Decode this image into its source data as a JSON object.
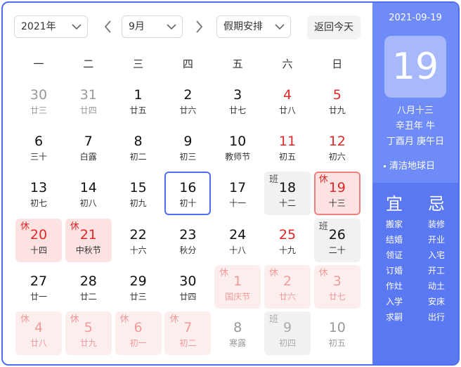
{
  "toolbar": {
    "year_select": "2021年",
    "month_select": "9月",
    "holiday_select": "假期安排",
    "today_button": "返回今天",
    "prev_icon": "chevron-left-icon",
    "next_icon": "chevron-right-icon"
  },
  "weekdays": [
    "一",
    "二",
    "三",
    "四",
    "五",
    "六",
    "日"
  ],
  "weeks": [
    [
      {
        "day": "30",
        "lunar": "廿三",
        "kind": "other"
      },
      {
        "day": "31",
        "lunar": "廿四",
        "kind": "other"
      },
      {
        "day": "1",
        "lunar": "廿五",
        "kind": "normal"
      },
      {
        "day": "2",
        "lunar": "廿六",
        "kind": "normal"
      },
      {
        "day": "3",
        "lunar": "廿七",
        "kind": "normal"
      },
      {
        "day": "4",
        "lunar": "廿八",
        "kind": "weekend"
      },
      {
        "day": "5",
        "lunar": "廿九",
        "kind": "weekend"
      }
    ],
    [
      {
        "day": "6",
        "lunar": "三十",
        "kind": "normal"
      },
      {
        "day": "7",
        "lunar": "白露",
        "kind": "normal"
      },
      {
        "day": "8",
        "lunar": "初二",
        "kind": "normal"
      },
      {
        "day": "9",
        "lunar": "初三",
        "kind": "normal"
      },
      {
        "day": "10",
        "lunar": "教师节",
        "kind": "normal"
      },
      {
        "day": "11",
        "lunar": "初五",
        "kind": "weekend"
      },
      {
        "day": "12",
        "lunar": "初六",
        "kind": "weekend"
      }
    ],
    [
      {
        "day": "13",
        "lunar": "初七",
        "kind": "normal"
      },
      {
        "day": "14",
        "lunar": "初八",
        "kind": "normal"
      },
      {
        "day": "15",
        "lunar": "初九",
        "kind": "normal"
      },
      {
        "day": "16",
        "lunar": "初十",
        "kind": "selected"
      },
      {
        "day": "17",
        "lunar": "十一",
        "kind": "normal"
      },
      {
        "day": "18",
        "lunar": "十二",
        "kind": "work",
        "badge": "班"
      },
      {
        "day": "19",
        "lunar": "十三",
        "kind": "current",
        "badge": "休"
      }
    ],
    [
      {
        "day": "20",
        "lunar": "十四",
        "kind": "hol",
        "badge": "休"
      },
      {
        "day": "21",
        "lunar": "中秋节",
        "kind": "hol",
        "badge": "休"
      },
      {
        "day": "22",
        "lunar": "十六",
        "kind": "normal"
      },
      {
        "day": "23",
        "lunar": "秋分",
        "kind": "normal"
      },
      {
        "day": "24",
        "lunar": "十八",
        "kind": "normal"
      },
      {
        "day": "25",
        "lunar": "十九",
        "kind": "weekend"
      },
      {
        "day": "26",
        "lunar": "二十",
        "kind": "work",
        "badge": "班"
      }
    ],
    [
      {
        "day": "27",
        "lunar": "廿一",
        "kind": "normal"
      },
      {
        "day": "28",
        "lunar": "廿二",
        "kind": "normal"
      },
      {
        "day": "29",
        "lunar": "廿三",
        "kind": "normal"
      },
      {
        "day": "30",
        "lunar": "廿四",
        "kind": "normal"
      },
      {
        "day": "1",
        "lunar": "国庆节",
        "kind": "holfaded",
        "badge": "休"
      },
      {
        "day": "2",
        "lunar": "廿六",
        "kind": "holfaded",
        "badge": "休"
      },
      {
        "day": "3",
        "lunar": "廿七",
        "kind": "holfaded",
        "badge": "休"
      }
    ],
    [
      {
        "day": "4",
        "lunar": "廿八",
        "kind": "holfaded",
        "badge": "休"
      },
      {
        "day": "5",
        "lunar": "廿九",
        "kind": "holfaded",
        "badge": "休"
      },
      {
        "day": "6",
        "lunar": "初一",
        "kind": "holfaded",
        "badge": "休"
      },
      {
        "day": "7",
        "lunar": "初二",
        "kind": "holfaded",
        "badge": "休"
      },
      {
        "day": "8",
        "lunar": "寒露",
        "kind": "other"
      },
      {
        "day": "9",
        "lunar": "初四",
        "kind": "workfaded",
        "badge": "班"
      },
      {
        "day": "10",
        "lunar": "初五",
        "kind": "other"
      }
    ]
  ],
  "panel": {
    "date": "2021-09-19",
    "day": "19",
    "lunar_date": "八月十三",
    "year_ganzhi": "辛丑年 牛",
    "month_day_ganzhi": "丁酉月 庚午日",
    "festival": "清洁地球日",
    "yi_title": "宜",
    "ji_title": "忌",
    "yi": [
      "搬家",
      "结婚",
      "领证",
      "订婚",
      "作灶",
      "入学",
      "求嗣"
    ],
    "ji": [
      "装修",
      "开业",
      "入宅",
      "开工",
      "动土",
      "安床",
      "出行"
    ]
  },
  "colors": {
    "accent": "#4e6ef2",
    "panel_bg": "#6e8bf7",
    "holiday_red": "#e02828"
  }
}
